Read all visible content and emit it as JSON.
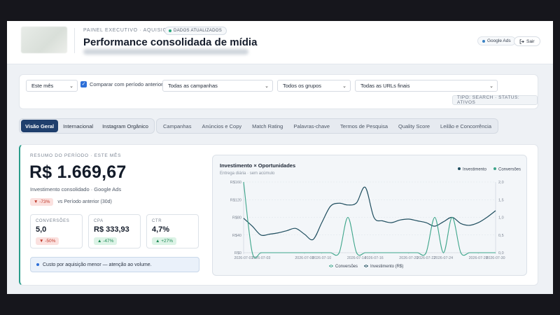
{
  "header": {
    "eyebrow": "PAINEL EXECUTIVO · AQUISIÇÃO",
    "updated_badge": "DADOS ATUALIZADOS",
    "title": "Performance consolidada de mídia",
    "source_chip": "Google Ads",
    "logout_label": "Sair",
    "colors": {
      "accent": "#2aa87f",
      "brand_navy": "#1f3f6d"
    }
  },
  "filters": {
    "period": "Este mês",
    "compare_label": "Comparar com período anterior",
    "compare_checked": true,
    "campaigns": "Todas as campanhas",
    "groups": "Todos os grupos",
    "urls": "Todas as URLs finais",
    "type_status": "TIPO: SEARCH · STATUS: ATIVOS"
  },
  "tabs_primary": [
    {
      "label": "Visão Geral",
      "active": true
    },
    {
      "label": "Internacional",
      "active": false
    },
    {
      "label": "Instagram Orgânico",
      "active": false
    }
  ],
  "tabs_secondary": [
    {
      "label": "Campanhas"
    },
    {
      "label": "Anúncios e Copy"
    },
    {
      "label": "Match Rating"
    },
    {
      "label": "Palavras-chave"
    },
    {
      "label": "Termos de Pesquisa"
    },
    {
      "label": "Quality Score"
    },
    {
      "label": "Leilão e Concorrência"
    }
  ],
  "summary": {
    "eyebrow": "RESUMO DO PERÍODO · ESTE MÊS",
    "big_value": "R$ 1.669,67",
    "big_sub": "Investimento consolidado · Google Ads",
    "delta": "▼ -73%",
    "delta_label": "vs Período anterior (30d)",
    "kpis": [
      {
        "label": "CONVERSÕES",
        "value": "5,0",
        "delta": "▼ -50%",
        "trend": "down"
      },
      {
        "label": "CPA",
        "value": "R$ 333,93",
        "delta": "▲ -47%",
        "trend": "up"
      },
      {
        "label": "CTR",
        "value": "4,7%",
        "delta": "▲ +27%",
        "trend": "up"
      }
    ],
    "note": "Custo por aquisição menor — atenção ao volume."
  },
  "chart_data": {
    "type": "line",
    "title": "Investimento × Oportunidades",
    "subtitle": "Entrega diária · sem acúmulo",
    "x": [
      "2026-07-01",
      "2026-07-02",
      "2026-07-03",
      "2026-07-04",
      "2026-07-05",
      "2026-07-06",
      "2026-07-07",
      "2026-07-08",
      "2026-07-09",
      "2026-07-10",
      "2026-07-11",
      "2026-07-12",
      "2026-07-13",
      "2026-07-14",
      "2026-07-15",
      "2026-07-16",
      "2026-07-17",
      "2026-07-18",
      "2026-07-19",
      "2026-07-20",
      "2026-07-21",
      "2026-07-22",
      "2026-07-23",
      "2026-07-24",
      "2026-07-25",
      "2026-07-26",
      "2026-07-27",
      "2026-07-28",
      "2026-07-29",
      "2026-07-30"
    ],
    "x_tick_labels": [
      "2026-07-01",
      "2026-07-03",
      "2026-07-08",
      "2026-07-10",
      "2026-07-14",
      "2026-07-16",
      "2026-07-20",
      "2026-07-22",
      "2026-07-24",
      "2026-07-28",
      "2026-07-30"
    ],
    "y_left": {
      "ticks": [
        "R$0",
        "R$40",
        "R$80",
        "R$120",
        "R$160"
      ],
      "range": [
        0,
        160
      ]
    },
    "y_right": {
      "ticks": [
        "0,0",
        "0,5",
        "1,0",
        "1,5",
        "2,0"
      ],
      "range": [
        0,
        2
      ]
    },
    "legend_top": [
      "Investimento",
      "Conversões"
    ],
    "legend_bottom": [
      "Conversões",
      "Investimento (R$)"
    ],
    "grid": true,
    "series": [
      {
        "name": "Investimento",
        "axis": "left",
        "color": "#1f4e5f",
        "values": [
          78,
          60,
          40,
          42,
          45,
          50,
          55,
          42,
          30,
          68,
          105,
          112,
          108,
          113,
          148,
          80,
          72,
          68,
          74,
          76,
          72,
          68,
          60,
          70,
          80,
          66,
          62,
          68,
          80,
          95
        ]
      },
      {
        "name": "Conversões",
        "axis": "right",
        "color": "#3da58a",
        "values": [
          2.0,
          0,
          0,
          0,
          0,
          0,
          0,
          0,
          0,
          0,
          0,
          0,
          1.0,
          0,
          0,
          0,
          0,
          0,
          0,
          0,
          0,
          0,
          1.0,
          0,
          1.0,
          0,
          0,
          0,
          0,
          0
        ]
      }
    ]
  }
}
